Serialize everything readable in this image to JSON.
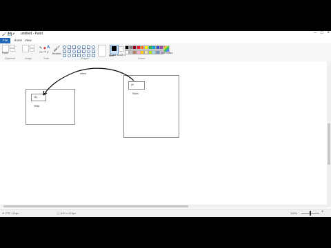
{
  "window": {
    "title": "untitled - Paint",
    "controls": [
      "–",
      "□",
      "×"
    ]
  },
  "tabs": [
    {
      "label": "File"
    },
    {
      "label": "Home"
    },
    {
      "label": "View"
    }
  ],
  "ribbon": {
    "groups": [
      "Clipboard",
      "Image",
      "Tools",
      "Shapes",
      "Size",
      "Colors"
    ],
    "paste_label": "Paste",
    "brushes_label": "Brushes",
    "size_label": "Size",
    "color1_label": "Color 1",
    "color2_label": "Color 2",
    "edit_colors_label": "Edit colors",
    "palette": [
      "#000000",
      "#7f7f7f",
      "#880015",
      "#ed1c24",
      "#ff7f27",
      "#fff200",
      "#22b14c",
      "#00a2e8",
      "#3f48cc",
      "#a349a4",
      "#ffffff",
      "#c3c3c3",
      "#b97a57",
      "#ffaec9",
      "#ffc90e",
      "#efe4b0",
      "#b5e61d",
      "#99d9ea",
      "#7092be",
      "#c8bfe7"
    ]
  },
  "drawing": {
    "left_box_label": "obj",
    "left_caption": "Heap",
    "right_box_label": "ptr",
    "right_caption": "Stack",
    "arrow_label": "refers"
  },
  "status": {
    "cursor": "✛ 273, 170px",
    "selection": "",
    "size": "⬜ 870 × 470px",
    "zoom": "100%"
  }
}
